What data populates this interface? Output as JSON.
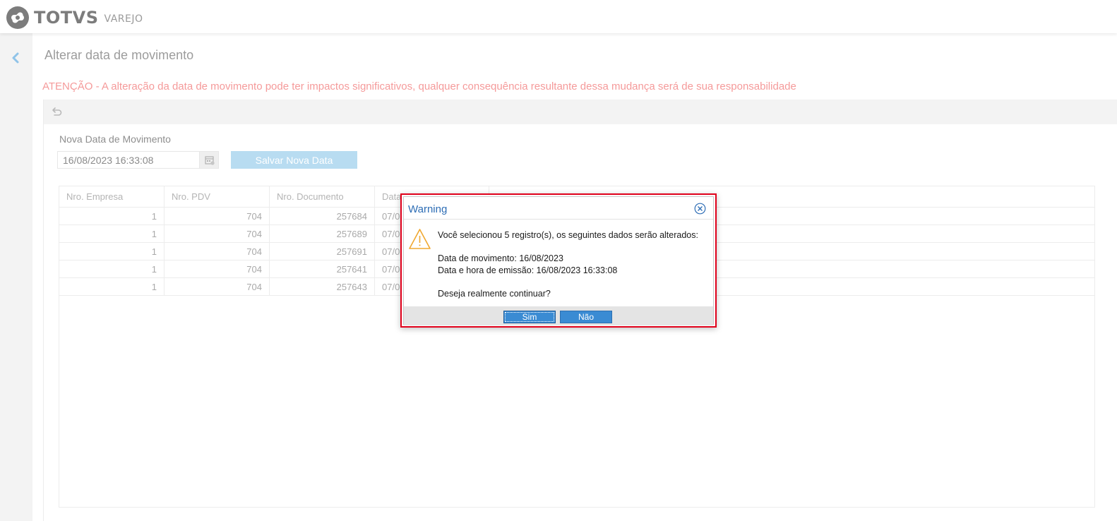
{
  "header": {
    "brand": "TOTVS",
    "product": "VAREJO"
  },
  "page": {
    "title": "Alterar data de movimento",
    "warning": "ATENÇÃO - A alteração da data de movimento pode ter impactos significativos, qualquer consequência resultante dessa mudança será de sua responsabilidade"
  },
  "form": {
    "label": "Nova Data de Movimento",
    "date_value": "16/08/2023 16:33:08",
    "save_label": "Salvar Nova Data"
  },
  "grid": {
    "columns": [
      "Nro. Empresa",
      "Nro. PDV",
      "Nro. Documento",
      "Data"
    ],
    "rows": [
      [
        "1",
        "704",
        "257684",
        "07/0"
      ],
      [
        "1",
        "704",
        "257689",
        "07/0"
      ],
      [
        "1",
        "704",
        "257691",
        "07/0"
      ],
      [
        "1",
        "704",
        "257641",
        "07/0"
      ],
      [
        "1",
        "704",
        "257643",
        "07/0"
      ]
    ]
  },
  "dialog": {
    "title": "Warning",
    "line1": "Você selecionou 5 registro(s), os seguintes dados serão alterados:",
    "line2": "Data de movimento: 16/08/2023",
    "line3": "Data e hora de emissão: 16/08/2023 16:33:08",
    "line4": "Deseja realmente continuar?",
    "yes_label": "Sim",
    "no_label": "Não"
  },
  "colors": {
    "accent": "#3a8bd3",
    "warning_text": "#f59a9a",
    "highlight_border": "#e0001b"
  }
}
